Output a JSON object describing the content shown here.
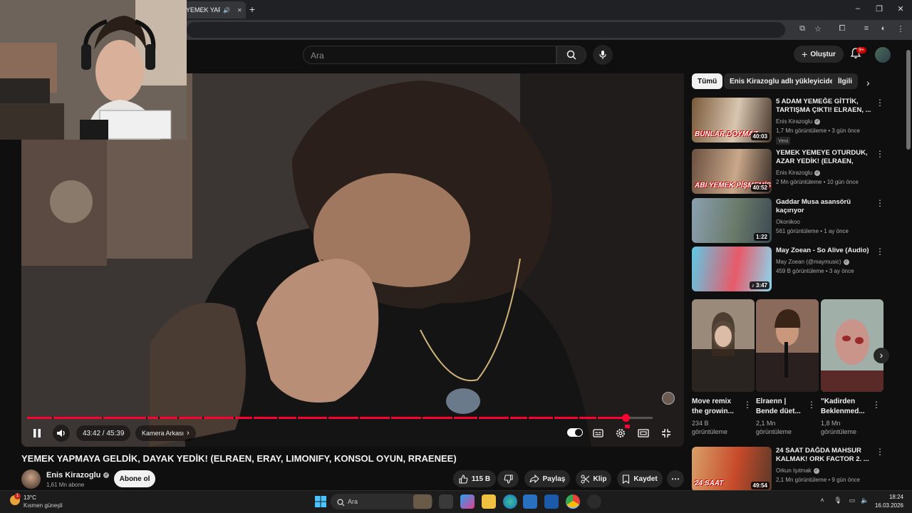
{
  "browser": {
    "tab_title": "YEMEK YAPMAYA GELDİK",
    "tab_close": "✕",
    "new_tab": "+"
  },
  "header": {
    "search_placeholder": "Ara",
    "create_label": "Oluştur",
    "notification_count": "9+"
  },
  "player": {
    "time": "43:42 / 45:39",
    "chapter": "Kamera Arkası",
    "progress_fraction": 0.957,
    "chapter_markers": [
      0.04,
      0.12,
      0.19,
      0.21,
      0.24,
      0.28,
      0.33,
      0.36,
      0.4,
      0.43,
      0.48,
      0.53,
      0.58,
      0.63,
      0.68,
      0.72,
      0.77,
      0.8,
      0.84,
      0.88,
      0.91
    ]
  },
  "video": {
    "title": "YEMEK YAPMAYA GELDİK, DAYAK YEDİK! (ELRAEN, ERAY, LIMONIFY, KONSOL OYUN, RRAENEE)",
    "channel": "Enis Kirazoglu",
    "subscribers": "1,61 Mn abone",
    "subscribe_label": "Abone ol",
    "likes": "115 B",
    "share_label": "Paylaş",
    "clip_label": "Klip",
    "save_label": "Kaydet"
  },
  "chips": [
    "Tümü",
    "Enis Kirazoglu adlı yükleyiciden",
    "İlgili"
  ],
  "recommendations": [
    {
      "title": "5 ADAM YEMEĞE GİTTİK, TARTIŞMA ÇIKTI! ELRAEN, ...",
      "channel": "Enis Kirazoglu",
      "verified": true,
      "meta": "1,7 Mn görüntüleme • 3 gün önce",
      "badge": "Yeni",
      "duration": "40:03",
      "thumb_text": "BUNLAR DOYMAZ",
      "thumb_colors": [
        "#7a5a3a",
        "#d9c6b0",
        "#4a3a2e"
      ]
    },
    {
      "title": "YEMEK YEMEYE OTURDUK, AZAR YEDİK! (ELRAEN, ERAY, ...",
      "channel": "Enis Kirazoglu",
      "verified": true,
      "meta": "2 Mn görüntüleme • 10 gün önce",
      "badge": "",
      "duration": "40:52",
      "thumb_text": "ABI YEMEK PİŞMEMİŞ",
      "thumb_colors": [
        "#6b5040",
        "#c9a88a",
        "#3a2e28"
      ]
    },
    {
      "title": "Gaddar Musa asansörü kaçırıyor",
      "channel": "Okonikoo",
      "verified": false,
      "meta": "561 görüntüleme • 1 ay önce",
      "badge": "",
      "duration": "1:22",
      "thumb_text": "",
      "thumb_colors": [
        "#8aa0b0",
        "#6a7a6a",
        "#3c4a52"
      ]
    },
    {
      "title": "May Zoean - So Alive (Audio)",
      "channel": "May Zoean (@maymusic)",
      "verified": true,
      "meta": "459 B görüntüleme • 3 ay önce",
      "badge": "",
      "duration": "♪ 3:47",
      "thumb_text": "",
      "thumb_colors": [
        "#5fc9e6",
        "#e85a6a",
        "#8ad8ef"
      ]
    },
    {
      "title": "24 SAAT DAĞDA MAHSUR KALMAK! ORK FACTOR 2. ...",
      "channel": "Orkun Işıtmak",
      "verified": true,
      "meta": "2,1 Mn görüntüleme • 9 gün önce",
      "badge": "",
      "duration": "49:54",
      "thumb_text": "24 SAAT",
      "thumb_colors": [
        "#d8a06a",
        "#c74a2a",
        "#5a3a2a"
      ]
    }
  ],
  "shorts": [
    {
      "title": "Move remix the growin...",
      "views": "234 B görüntüleme",
      "colors": [
        "#9a8a7a",
        "#2a2420"
      ]
    },
    {
      "title": "Elraenn | Bende düet...",
      "views": "2,1 Mn görüntüleme",
      "colors": [
        "#8a6a5a",
        "#2a2020"
      ]
    },
    {
      "title": "\"Kadirden Beklenmed...",
      "views": "1,8 Mn görüntüleme",
      "colors": [
        "#a0b0a8",
        "#5a2a28"
      ]
    }
  ],
  "taskbar": {
    "temperature": "13°C",
    "weather": "Kısmen güneşli",
    "weather_badge": "1",
    "search_placeholder": "Ara",
    "time": "18:24",
    "date": "16.03.2026"
  },
  "colors": {
    "accent_red": "#ff0033",
    "background": "#0f0f0f",
    "chip": "#272727"
  }
}
